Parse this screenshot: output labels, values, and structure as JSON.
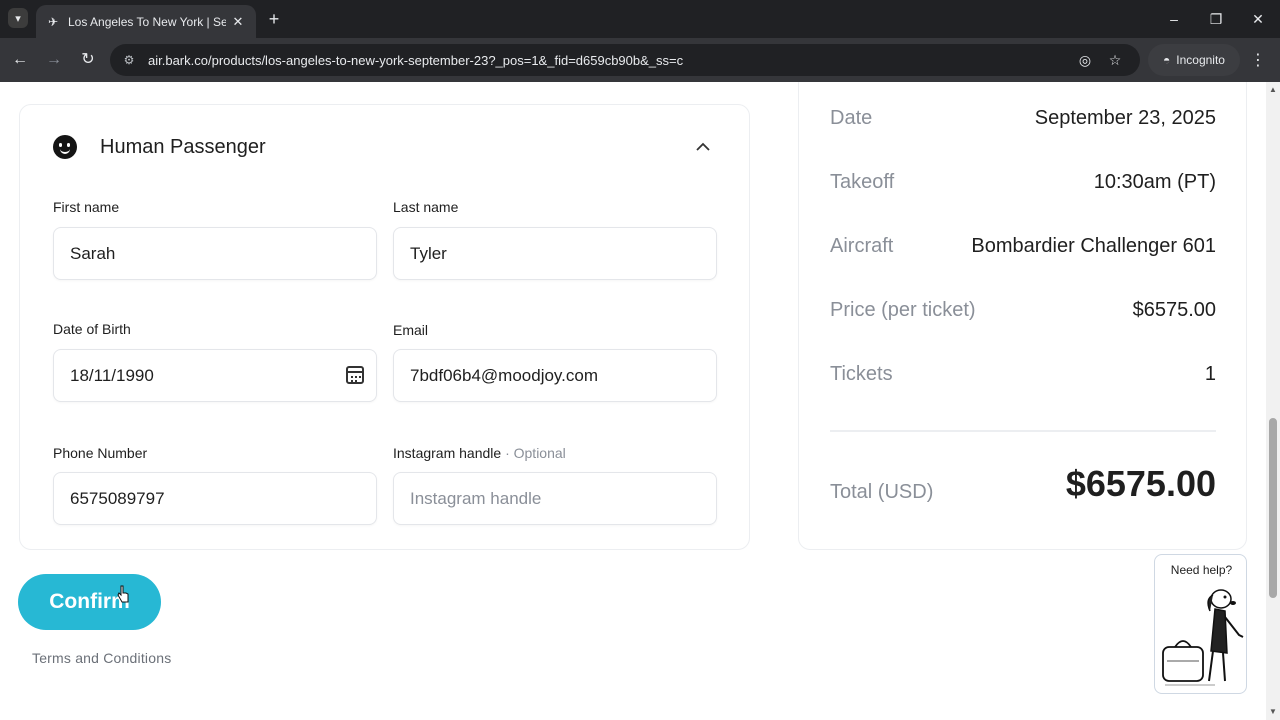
{
  "browser": {
    "tab_title": "Los Angeles To New York | Sept",
    "url": "air.bark.co/products/los-angeles-to-new-york-september-23?_pos=1&_fid=d659cb90b&_ss=c",
    "incognito_label": "Incognito"
  },
  "passenger_card": {
    "title": "Human Passenger",
    "first_name_label": "First name",
    "first_name_value": "Sarah",
    "last_name_label": "Last name",
    "last_name_value": "Tyler",
    "dob_label": "Date of Birth",
    "dob_value": "18/11/1990",
    "email_label": "Email",
    "email_value": "7bdf06b4@moodjoy.com",
    "phone_label": "Phone Number",
    "phone_value": "6575089797",
    "instagram_label": "Instagram handle",
    "instagram_optional": "· Optional",
    "instagram_placeholder": "Instagram handle"
  },
  "actions": {
    "confirm_label": "Confirm",
    "terms_label": "Terms and Conditions"
  },
  "summary": {
    "rows": [
      {
        "key": "Date",
        "value": "September 23, 2025"
      },
      {
        "key": "Takeoff",
        "value": "10:30am (PT)"
      },
      {
        "key": "Aircraft",
        "value": "Bombardier Challenger 601"
      },
      {
        "key": "Price (per ticket)",
        "value": "$6575.00"
      },
      {
        "key": "Tickets",
        "value": "1"
      }
    ],
    "total_label": "Total (USD)",
    "total_value": "$6575.00"
  },
  "help_widget": {
    "label": "Need help?"
  },
  "colors": {
    "accent": "#27b8d4",
    "text": "#1f1f1f",
    "muted": "#8a8f98"
  }
}
